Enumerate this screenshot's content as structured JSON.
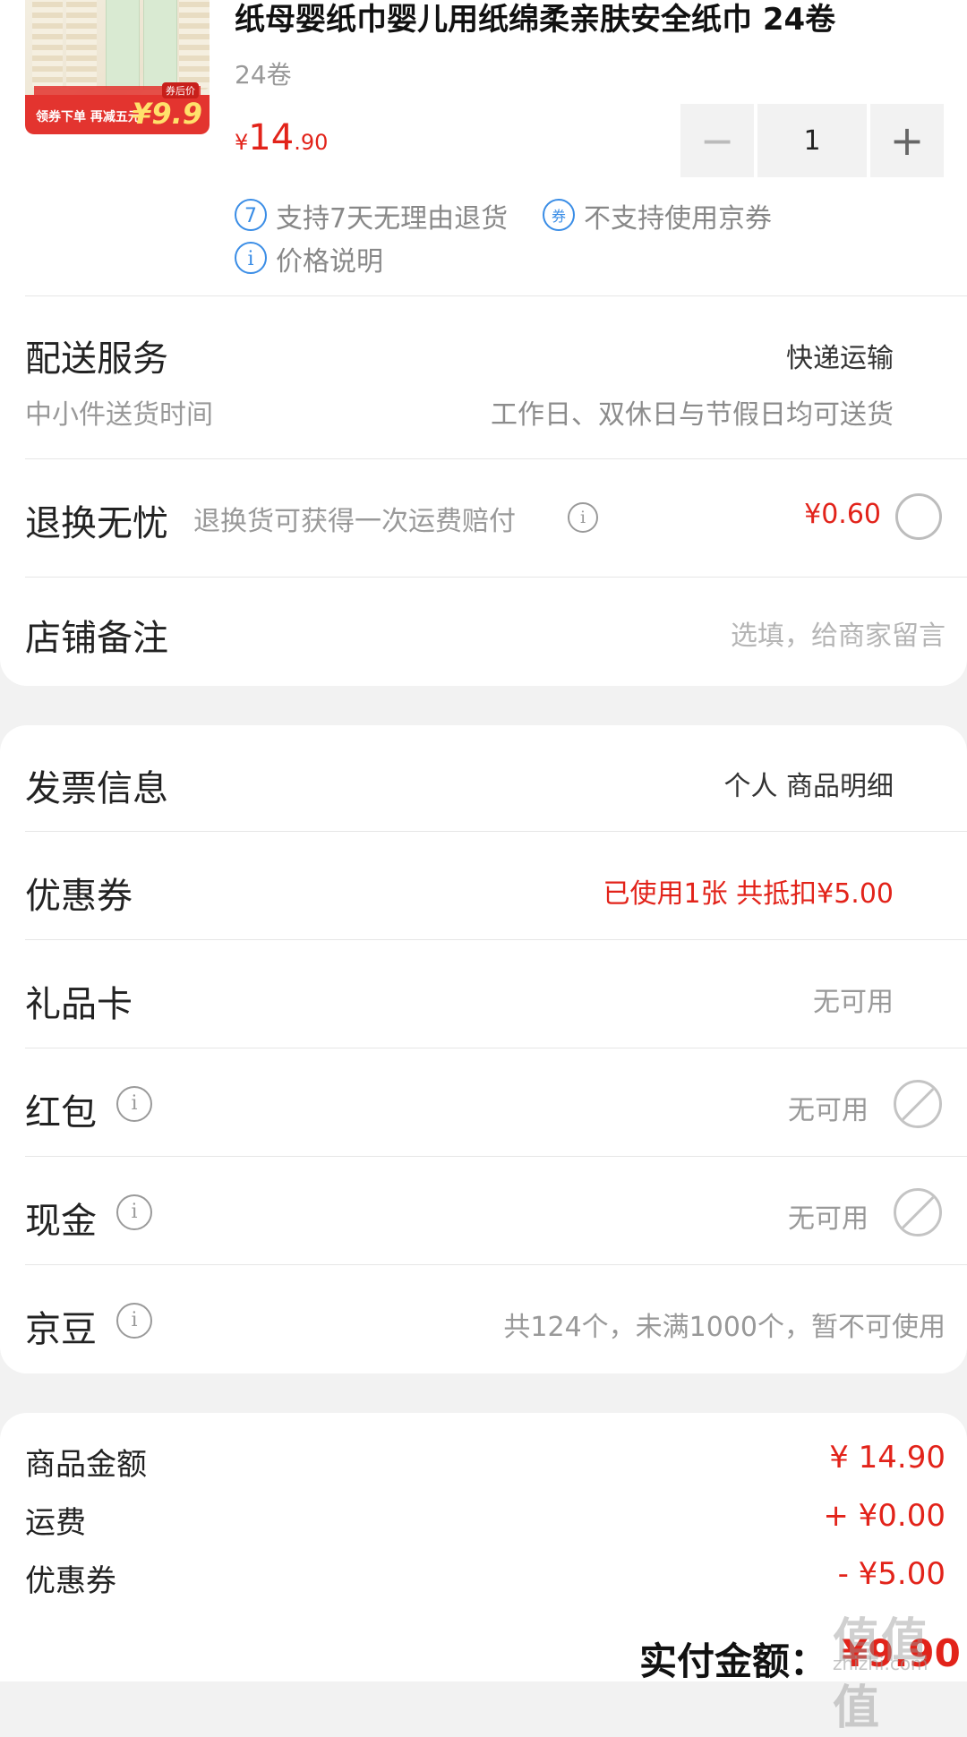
{
  "product": {
    "title": "纸母婴纸巾婴儿用纸绵柔亲肤安全纸巾 24卷",
    "spec": "24卷",
    "price_currency": "¥",
    "price_int": "14",
    "price_dec": ".90",
    "image_banner_text": "领券下单 再减五元",
    "image_badge_label": "券后价",
    "image_badge_price": "¥9.9",
    "quantity": "1",
    "minus_symbol": "−",
    "plus_symbol": "+",
    "services": {
      "return_icon_text": "7",
      "return_text": "支持7天无理由退货",
      "coupon_icon_text": "券",
      "coupon_text": "不支持使用京券",
      "price_icon_text": "i",
      "price_text": "价格说明"
    }
  },
  "delivery": {
    "label": "配送服务",
    "value": "快递运输",
    "sub_label": "中小件送货时间",
    "sub_value": "工作日、双休日与节假日均可送货"
  },
  "return_insurance": {
    "label": "退换无忧",
    "desc": "退换货可获得一次运费赔付",
    "price": "¥0.60"
  },
  "store_note": {
    "label": "店铺备注",
    "placeholder": "选填，给商家留言"
  },
  "invoice": {
    "label": "发票信息",
    "value": "个人 商品明细"
  },
  "coupon": {
    "label": "优惠券",
    "value": "已使用1张 共抵扣¥5.00"
  },
  "gift_card": {
    "label": "礼品卡",
    "value": "无可用"
  },
  "red_packet": {
    "label": "红包",
    "value": "无可用"
  },
  "cash": {
    "label": "现金",
    "value": "无可用"
  },
  "jingdou": {
    "label": "京豆",
    "value": "共124个，未满1000个，暂不可使用"
  },
  "summary": {
    "goods_label": "商品金额",
    "goods_value": "¥ 14.90",
    "shipping_label": "运费",
    "shipping_value": "+ ¥0.00",
    "coupon_label": "优惠券",
    "coupon_value": "- ¥5.00",
    "total_label": "实付金额：",
    "total_value": "¥9.90"
  },
  "watermark": {
    "main": "值值值",
    "sub": "zhizhi.com"
  },
  "colors": {
    "accent_red": "#e2231a",
    "service_blue": "#3a8de6",
    "background": "#f2f2f2"
  }
}
